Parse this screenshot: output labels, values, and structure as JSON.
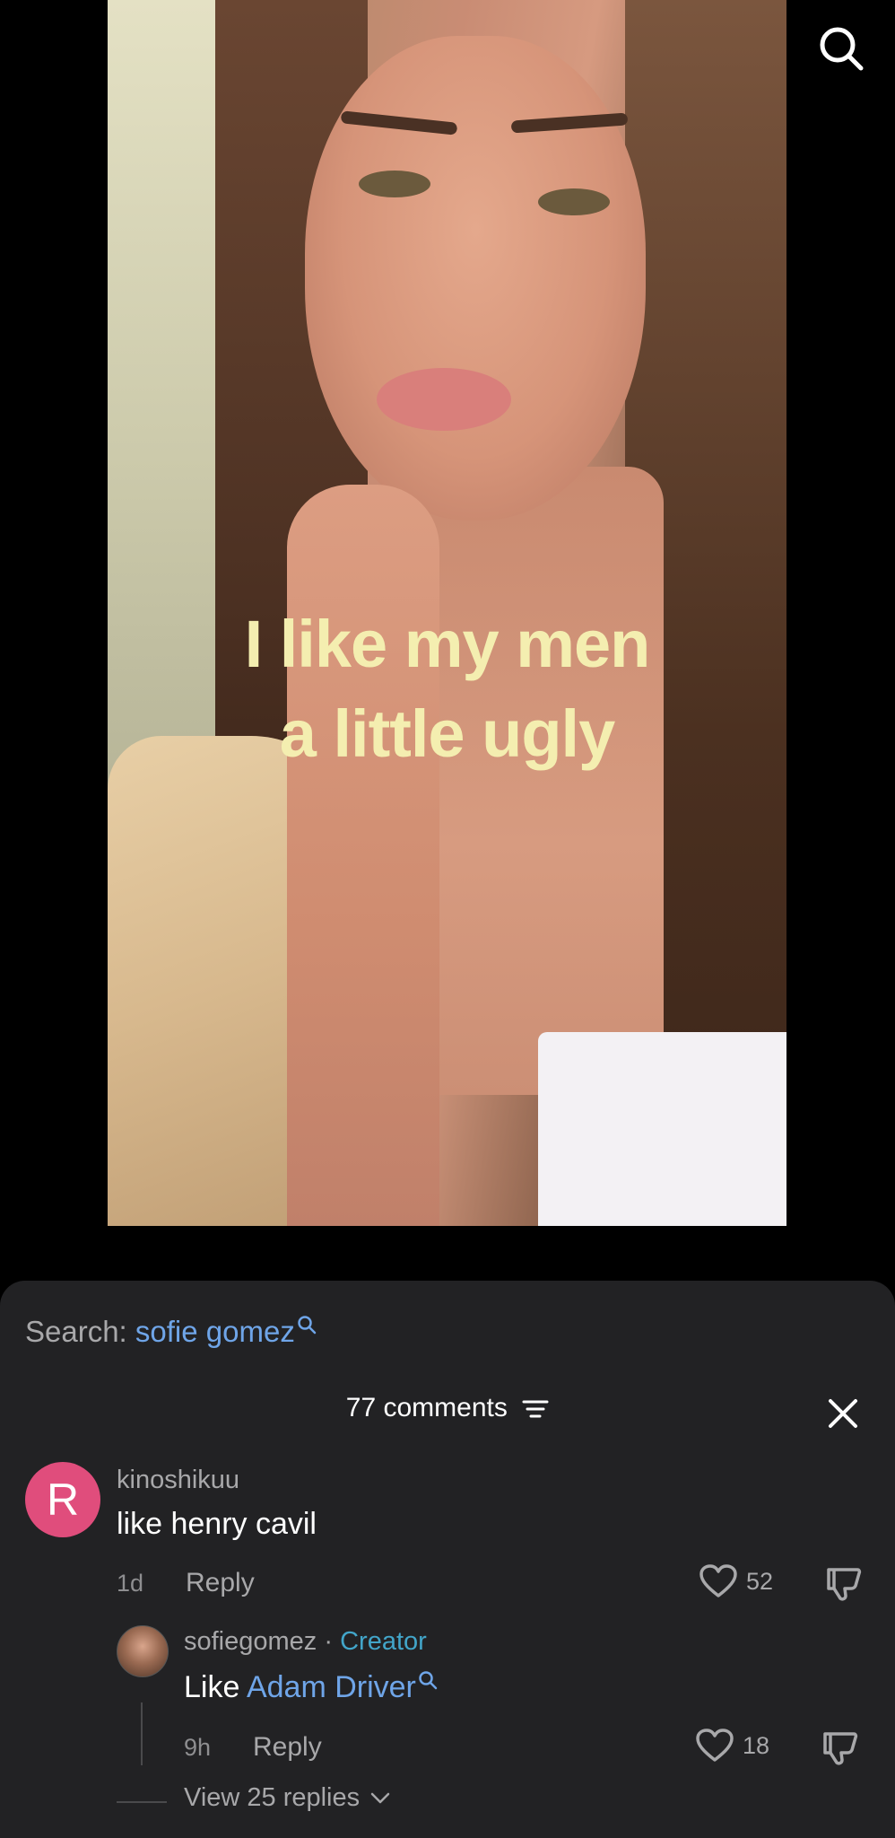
{
  "video": {
    "caption_line1": "I like my men",
    "caption_line2": "a little ugly"
  },
  "search": {
    "label": "Search:",
    "term": "sofie gomez"
  },
  "comments_header": {
    "count_label": "77 comments"
  },
  "comments": [
    {
      "avatar_letter": "R",
      "username": "kinoshikuu",
      "text": "like henry cavil",
      "time": "1d",
      "reply_label": "Reply",
      "likes": "52"
    }
  ],
  "reply": {
    "username": "sofiegomez",
    "separator": " · ",
    "badge": "Creator",
    "text_prefix": "Like ",
    "mention": "Adam Driver",
    "time": "9h",
    "reply_label": "Reply",
    "likes": "18"
  },
  "view_replies_label": "View 25 replies",
  "colors": {
    "sheet_bg": "#222224",
    "link_blue": "#6fa5e8",
    "creator_teal": "#42a5c9",
    "avatar_pink": "#e04d7c",
    "caption_yellow": "#f4eeb0"
  },
  "icons": [
    "search-icon",
    "filter-icon",
    "close-icon",
    "heart-icon",
    "dislike-icon",
    "chevron-down-icon"
  ]
}
